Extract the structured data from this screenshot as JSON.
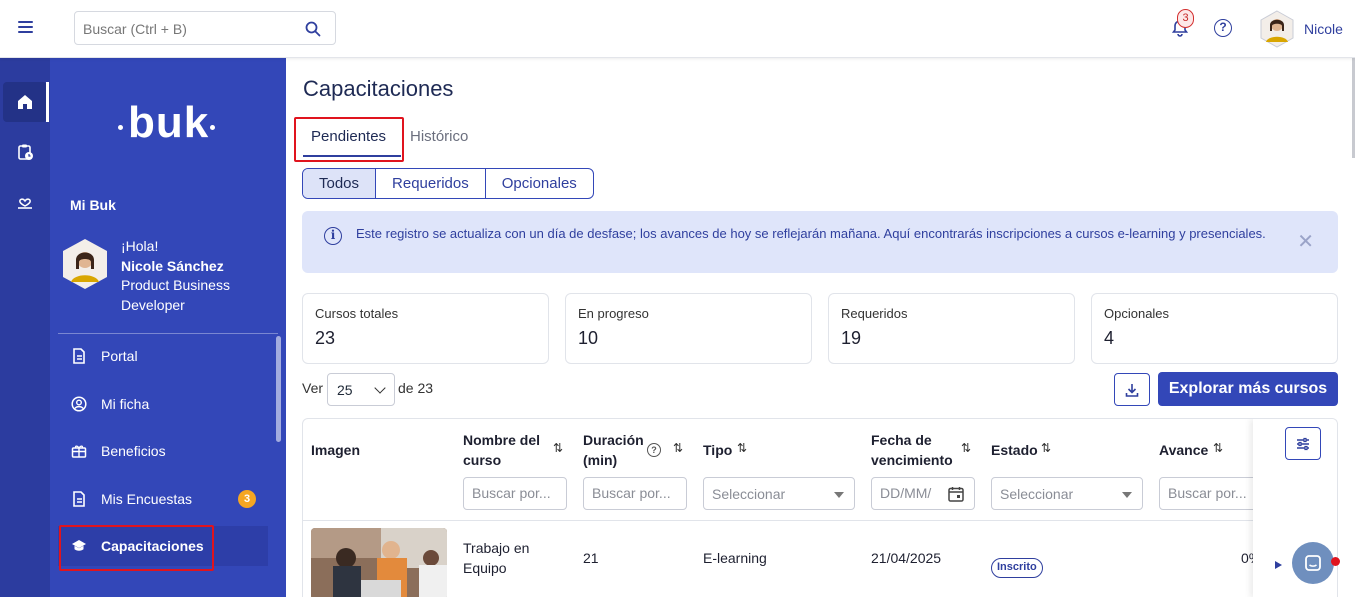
{
  "topbar": {
    "search_placeholder": "Buscar (Ctrl + B)",
    "notifications_count": "3",
    "help_label": "?",
    "user_name": "Nicole"
  },
  "sidebar": {
    "logo": "buk",
    "section_title": "Mi Buk",
    "greeting": "¡Hola!",
    "user_full_name": "Nicole Sánchez",
    "user_role": "Product Business Developer",
    "items": [
      {
        "label": "Portal",
        "icon": "document-icon"
      },
      {
        "label": "Mi ficha",
        "icon": "user-circle-icon"
      },
      {
        "label": "Beneficios",
        "icon": "gift-icon"
      },
      {
        "label": "Mis Encuestas",
        "icon": "document-icon",
        "badge": "3"
      },
      {
        "label": "Capacitaciones",
        "icon": "graduation-cap-icon",
        "active": true
      }
    ]
  },
  "main": {
    "title": "Capacitaciones",
    "tabs": [
      {
        "label": "Pendientes",
        "active": true
      },
      {
        "label": "Histórico",
        "active": false
      }
    ],
    "filters": [
      {
        "label": "Todos",
        "active": true
      },
      {
        "label": "Requeridos",
        "active": false
      },
      {
        "label": "Opcionales",
        "active": false
      }
    ],
    "info_text": "Este registro se actualiza con un día de desfase; los avances de hoy se reflejarán mañana. Aquí encontrarás inscripciones a cursos e-learning y presenciales.",
    "info_close": "✕",
    "stats": [
      {
        "label": "Cursos totales",
        "value": "23"
      },
      {
        "label": "En progreso",
        "value": "10"
      },
      {
        "label": "Requeridos",
        "value": "19"
      },
      {
        "label": "Opcionales",
        "value": "4"
      }
    ],
    "pagination": {
      "ver_label": "Ver",
      "per_page": "25",
      "of_label": "de 23"
    },
    "explore_button": "Explorar más cursos"
  },
  "table": {
    "columns": {
      "imagen": "Imagen",
      "nombre_line1": "Nombre del",
      "nombre_line2": "curso",
      "duracion_line1": "Duración",
      "duracion_line2": "(min)",
      "tipo": "Tipo",
      "fecha_line1": "Fecha de",
      "fecha_line2": "vencimiento",
      "estado": "Estado",
      "avance": "Avance"
    },
    "filters": {
      "nombre_placeholder": "Buscar por...",
      "duracion_placeholder": "Buscar por...",
      "tipo_select": "Seleccionar",
      "fecha_placeholder": "DD/MM/",
      "estado_select": "Seleccionar",
      "avance_placeholder": "Buscar por..."
    },
    "rows": [
      {
        "nombre_line1": "Trabajo en",
        "nombre_line2": "Equipo",
        "duracion": "21",
        "tipo": "E-learning",
        "fecha": "21/04/2025",
        "estado": "Inscrito",
        "avance": "0%"
      }
    ]
  },
  "colors": {
    "brand": "#3347b8",
    "brand_dark": "#2c3c9f",
    "info_bg": "#dfe5fa",
    "highlight": "#e0141e"
  }
}
